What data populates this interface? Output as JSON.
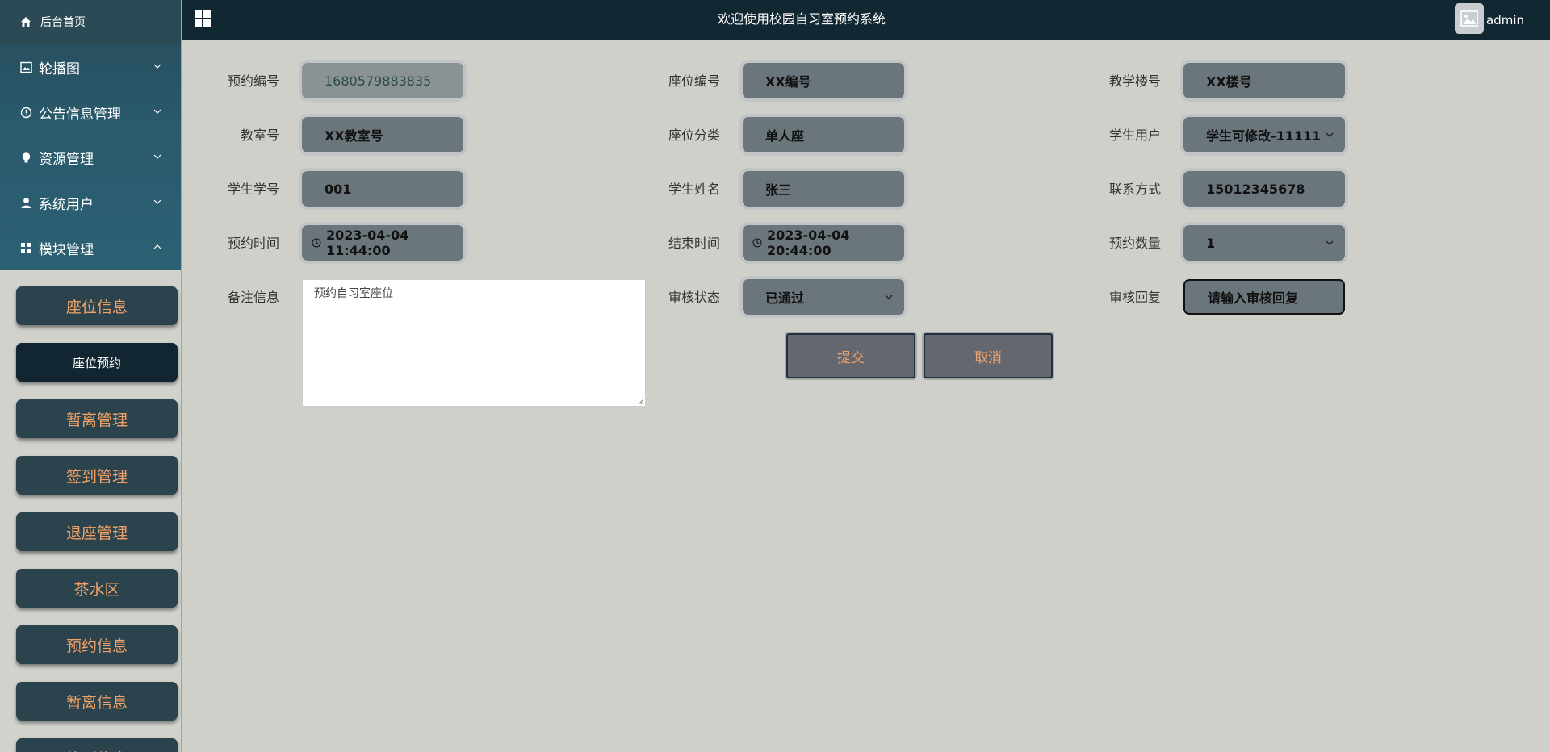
{
  "header": {
    "title": "欢迎使用校园自习室预约系统",
    "username": "admin"
  },
  "sidebar": {
    "home": "后台首页",
    "menus": [
      {
        "label": "轮播图",
        "icon": "image-icon",
        "state": "collapsed"
      },
      {
        "label": "公告信息管理",
        "icon": "info-icon",
        "state": "collapsed"
      },
      {
        "label": "资源管理",
        "icon": "lightbulb-icon",
        "state": "collapsed"
      },
      {
        "label": "系统用户",
        "icon": "user-icon",
        "state": "collapsed"
      },
      {
        "label": "模块管理",
        "icon": "grid-icon",
        "state": "expanded"
      }
    ],
    "submenu": [
      "座位信息",
      "座位预约",
      "暂离管理",
      "签到管理",
      "退座管理",
      "茶水区",
      "预约信息",
      "暂离信息",
      "签到信息"
    ],
    "active_submenu": "座位预约"
  },
  "form": {
    "booking_no": {
      "label": "预约编号",
      "value": "1680579883835"
    },
    "seat_no": {
      "label": "座位编号",
      "value": "XX编号"
    },
    "building_no": {
      "label": "教学楼号",
      "value": "XX楼号"
    },
    "room_no": {
      "label": "教室号",
      "value": "XX教室号"
    },
    "seat_type": {
      "label": "座位分类",
      "value": "单人座"
    },
    "student_user": {
      "label": "学生用户",
      "value": "学生可修改-11111"
    },
    "student_id": {
      "label": "学生学号",
      "value": "001"
    },
    "student_name": {
      "label": "学生姓名",
      "value": "张三"
    },
    "contact": {
      "label": "联系方式",
      "value": "15012345678"
    },
    "book_time": {
      "label": "预约时间",
      "value": "2023-04-04 11:44:00"
    },
    "end_time": {
      "label": "结束时间",
      "value": "2023-04-04 20:44:00"
    },
    "quantity": {
      "label": "预约数量",
      "value": "1"
    },
    "remark": {
      "label": "备注信息",
      "placeholder": "预约自习室座位"
    },
    "review_status": {
      "label": "审核状态",
      "value": "已通过"
    },
    "review_reply": {
      "label": "审核回复",
      "placeholder": "请输入审核回复"
    },
    "submit_label": "提交",
    "cancel_label": "取消"
  },
  "colors": {
    "sidebar_top": "#2a5b6d",
    "header_bg": "#112833",
    "accent_text": "#f2a36a",
    "field_bg": "#6b757c",
    "page_bg": "#cfd0ca"
  }
}
